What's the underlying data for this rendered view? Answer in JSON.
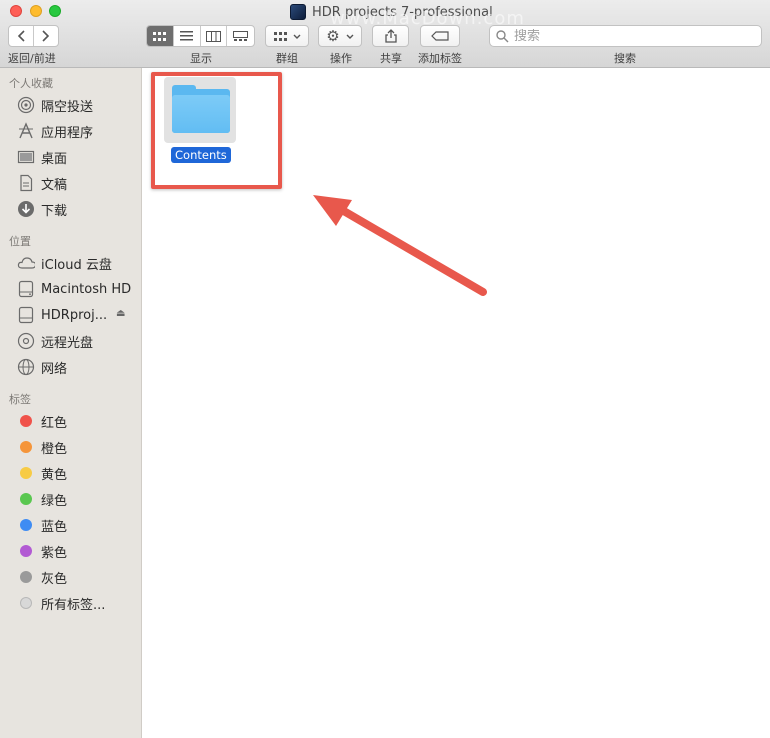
{
  "window": {
    "title": "HDR projects 7-professional",
    "watermark": "www.MacDown.com"
  },
  "toolbar": {
    "nav_label": "返回/前进",
    "view_label": "显示",
    "group_label": "群组",
    "action_label": "操作",
    "share_label": "共享",
    "tags_label": "添加标签",
    "search_label": "搜索",
    "search_placeholder": "搜索"
  },
  "sidebar": {
    "favorites_header": "个人收藏",
    "favorites": [
      {
        "label": "隔空投送",
        "icon": "airdrop-icon"
      },
      {
        "label": "应用程序",
        "icon": "applications-icon"
      },
      {
        "label": "桌面",
        "icon": "desktop-icon"
      },
      {
        "label": "文稿",
        "icon": "documents-icon"
      },
      {
        "label": "下载",
        "icon": "downloads-icon"
      }
    ],
    "locations_header": "位置",
    "locations": [
      {
        "label": "iCloud 云盘",
        "icon": "icloud-icon"
      },
      {
        "label": "Macintosh HD",
        "icon": "harddisk-icon"
      },
      {
        "label": "HDRproj...",
        "icon": "disk-image-icon"
      },
      {
        "label": "远程光盘",
        "icon": "remote-disc-icon"
      },
      {
        "label": "网络",
        "icon": "network-icon"
      }
    ],
    "tags_header": "标签",
    "tags": [
      {
        "label": "红色",
        "color": "#f0524a"
      },
      {
        "label": "橙色",
        "color": "#f5953a"
      },
      {
        "label": "黄色",
        "color": "#f7cb45"
      },
      {
        "label": "绿色",
        "color": "#5ac750"
      },
      {
        "label": "蓝色",
        "color": "#3f8cf3"
      },
      {
        "label": "紫色",
        "color": "#b25ad3"
      },
      {
        "label": "灰色",
        "color": "#9a9a9a"
      },
      {
        "label": "所有标签...",
        "color": "#d8d8d8"
      }
    ]
  },
  "content": {
    "folder_name": "Contents"
  },
  "colors": {
    "annotation": "#e8584c",
    "selection": "#1f67d8",
    "folder": "#62bdf3"
  }
}
